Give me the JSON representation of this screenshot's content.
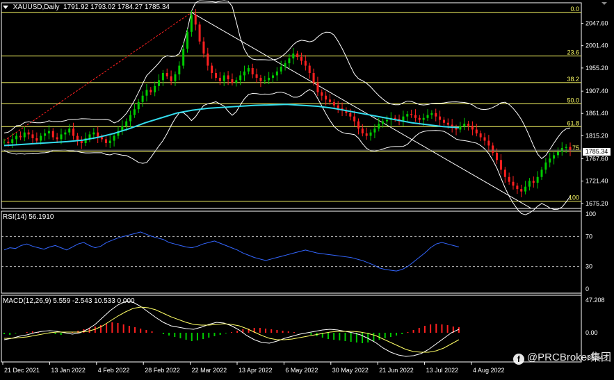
{
  "header": {
    "symbol": "XAUUSD,Daily",
    "open": "1791.92",
    "high": "1793.02",
    "low": "1784.27",
    "close": "1785.34"
  },
  "current_price_label": "1785.34",
  "rsi_label": "RSI(14) 56.1910",
  "macd_label": "MACD(12,26,9) 5.559 -2.543 10.533 0.000",
  "watermark": "@PRCBroker集团",
  "colors": {
    "background": "#000000",
    "grid": "#ffffff",
    "bull": "#00cc00",
    "bear": "#ff2020",
    "fib": "#ffff66",
    "ma": "#33ddee",
    "bands": "#ffffff",
    "rsi": "#3366ff",
    "macd_signal": "#ffff66"
  },
  "chart_data": [
    {
      "type": "candlestick",
      "title": "XAUUSD,Daily",
      "x": [
        "21 Dec 2021",
        "13 Jan 2022",
        "4 Feb 2022",
        "28 Feb 2022",
        "22 Mar 2022",
        "13 Apr 2022",
        "6 May 2022",
        "30 May 2022",
        "21 Jun 2022",
        "13 Jul 2022",
        "4 Aug 2022"
      ],
      "y_ticks": [
        "2047.60",
        "2001.40",
        "1955.20",
        "1907.40",
        "1861.40",
        "1815.20",
        "1767.60",
        "1721.40",
        "1675.20"
      ],
      "ylim": [
        1665,
        2090
      ],
      "fibonacci": [
        {
          "level": "0.0",
          "price": 2070
        },
        {
          "level": "23.6",
          "price": 1980
        },
        {
          "level": "38.2",
          "price": 1925
        },
        {
          "level": "50.0",
          "price": 1881
        },
        {
          "level": "61.8",
          "price": 1834
        },
        {
          "level": "75",
          "price": 1783
        },
        {
          "level": "100",
          "price": 1680
        }
      ],
      "close_series": [
        1803,
        1800,
        1808,
        1815,
        1812,
        1822,
        1818,
        1810,
        1805,
        1815,
        1820,
        1825,
        1812,
        1808,
        1818,
        1822,
        1830,
        1815,
        1805,
        1800,
        1810,
        1818,
        1822,
        1812,
        1808,
        1800,
        1805,
        1815,
        1825,
        1835,
        1845,
        1858,
        1870,
        1885,
        1898,
        1910,
        1905,
        1918,
        1930,
        1945,
        1938,
        1928,
        1942,
        1960,
        1995,
        2030,
        2065,
        2045,
        2010,
        1985,
        1960,
        1945,
        1935,
        1928,
        1940,
        1932,
        1925,
        1930,
        1940,
        1948,
        1955,
        1942,
        1935,
        1928,
        1930,
        1935,
        1940,
        1948,
        1958,
        1965,
        1975,
        1985,
        1978,
        1970,
        1960,
        1945,
        1925,
        1905,
        1898,
        1890,
        1885,
        1878,
        1872,
        1868,
        1862,
        1855,
        1845,
        1830,
        1820,
        1815,
        1822,
        1830,
        1840,
        1845,
        1848,
        1852,
        1850,
        1845,
        1855,
        1860,
        1858,
        1852,
        1848,
        1852,
        1858,
        1862,
        1855,
        1848,
        1842,
        1838,
        1832,
        1828,
        1835,
        1840,
        1836,
        1828,
        1820,
        1812,
        1805,
        1795,
        1780,
        1765,
        1745,
        1730,
        1720,
        1712,
        1705,
        1700,
        1710,
        1722,
        1718,
        1730,
        1745,
        1760,
        1768,
        1775,
        1782,
        1790,
        1792,
        1785
      ],
      "ma_series": [
        1795,
        1797,
        1799,
        1801,
        1803,
        1806,
        1812,
        1820,
        1830,
        1842,
        1852,
        1862,
        1868,
        1872,
        1874,
        1876,
        1878,
        1879,
        1880,
        1878,
        1876,
        1872,
        1866,
        1860,
        1854,
        1848,
        1842,
        1838,
        1834,
        1832
      ],
      "trendline": {
        "from": {
          "x": "28 Feb 2022",
          "y": 2070
        },
        "to": {
          "x": "4 Aug 2022",
          "y": 1760
        }
      },
      "current_price": 1785.34
    },
    {
      "type": "line",
      "title": "RSI(14) 56.1910",
      "y_ticks": [
        "100",
        "70",
        "30",
        "0"
      ],
      "ylim": [
        0,
        100
      ],
      "levels": [
        70,
        30
      ],
      "values": [
        52,
        55,
        54,
        58,
        60,
        57,
        55,
        53,
        56,
        58,
        55,
        52,
        56,
        60,
        62,
        58,
        55,
        57,
        62,
        65,
        68,
        70,
        72,
        74,
        76,
        73,
        70,
        68,
        66,
        62,
        60,
        58,
        56,
        55,
        57,
        60,
        62,
        64,
        61,
        58,
        55,
        52,
        48,
        45,
        42,
        40,
        38,
        40,
        42,
        44,
        46,
        48,
        50,
        52,
        50,
        48,
        47,
        46,
        45,
        44,
        43,
        42,
        40,
        38,
        35,
        32,
        28,
        26,
        25,
        24,
        26,
        30,
        36,
        42,
        48,
        55,
        60,
        62,
        60,
        58,
        56
      ]
    },
    {
      "type": "bar",
      "title": "MACD(12,26,9) 5.559 -2.543 10.533 0.000",
      "y_ticks": [
        "47.208",
        "0.00",
        "-35.84"
      ],
      "ylim": [
        -38,
        50
      ],
      "histogram": [
        -2,
        -3,
        -1,
        0,
        1,
        2,
        1,
        0,
        -1,
        -2,
        -3,
        -1,
        1,
        3,
        5,
        7,
        9,
        11,
        13,
        15,
        14,
        12,
        10,
        8,
        6,
        4,
        2,
        0,
        -2,
        -4,
        -6,
        -8,
        -10,
        -12,
        -11,
        -9,
        -7,
        -5,
        -3,
        -1,
        1,
        3,
        5,
        6,
        7,
        7,
        6,
        5,
        4,
        3,
        2,
        1,
        0,
        -1,
        -3,
        -5,
        -7,
        -9,
        -10,
        -11,
        -12,
        -13,
        -14,
        -15,
        -14,
        -12,
        -10,
        -8,
        -6,
        -4,
        -2,
        1,
        4,
        7,
        10,
        12,
        13,
        12,
        11,
        9,
        8
      ],
      "macd_line": [
        -10,
        -8,
        -5,
        -3,
        0,
        2,
        3,
        2,
        0,
        -2,
        0,
        5,
        12,
        22,
        32,
        40,
        45,
        44,
        38,
        30,
        22,
        15,
        10,
        8,
        6,
        5,
        8,
        12,
        15,
        14,
        10,
        4,
        -4,
        -10,
        -14,
        -15,
        -12,
        -8,
        -5,
        -2,
        0,
        2,
        4,
        5,
        4,
        2,
        0,
        -3,
        -8,
        -14,
        -22,
        -28,
        -32,
        -34,
        -33,
        -30,
        -24,
        -16,
        -8,
        0,
        5
      ],
      "signal_line": [
        -8,
        -8,
        -7,
        -6,
        -4,
        -2,
        0,
        1,
        1,
        1,
        1,
        2,
        5,
        10,
        17,
        24,
        30,
        35,
        37,
        36,
        33,
        28,
        23,
        19,
        15,
        12,
        11,
        11,
        12,
        13,
        12,
        10,
        6,
        1,
        -4,
        -8,
        -10,
        -10,
        -9,
        -7,
        -5,
        -3,
        -1,
        1,
        2,
        2,
        2,
        1,
        -1,
        -4,
        -9,
        -14,
        -19,
        -24,
        -27,
        -28,
        -28,
        -26,
        -22,
        -16,
        -10
      ]
    }
  ]
}
